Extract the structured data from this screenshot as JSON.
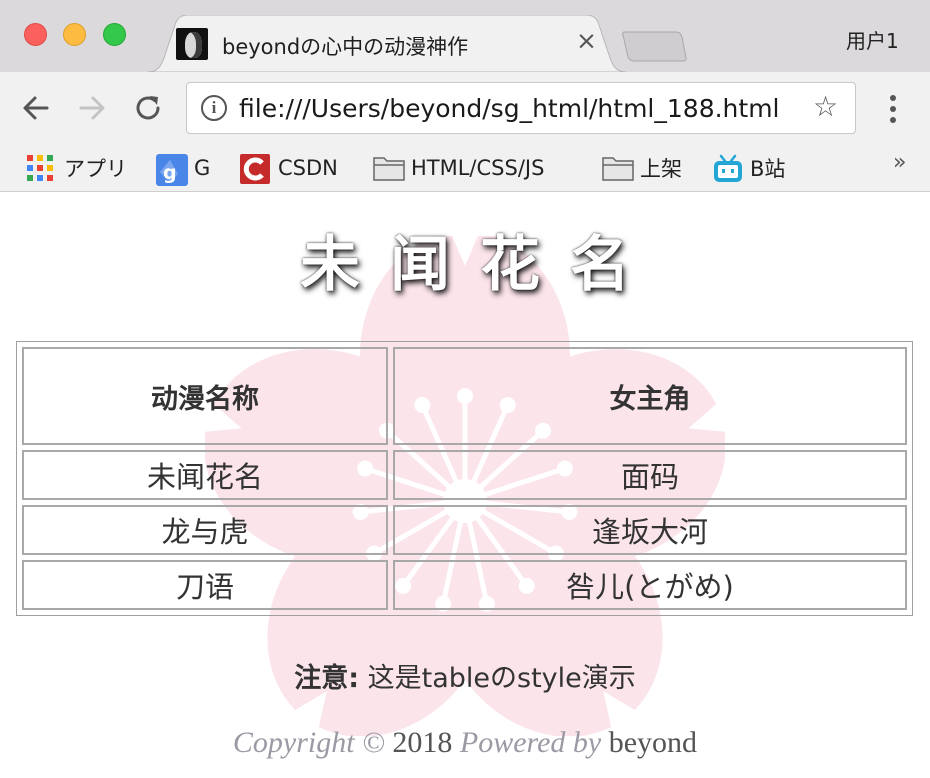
{
  "browser": {
    "tab": {
      "title": "beyondの心中の动漫神作",
      "close_glyph": "×"
    },
    "profile": "用户1",
    "address": {
      "url": "file:///Users/beyond/sg_html/html_188.html"
    },
    "bookmarks": [
      {
        "label": "アプリ",
        "icon": "apps-grid-icon"
      },
      {
        "label": "G",
        "icon": "google-icon"
      },
      {
        "label": "CSDN",
        "icon": "csdn-icon"
      },
      {
        "label": "HTML/CSS/JS",
        "icon": "folder-icon"
      },
      {
        "label": "上架",
        "icon": "folder-icon"
      },
      {
        "label": "B站",
        "icon": "bilibili-icon"
      }
    ],
    "bookmarks_overflow": "»"
  },
  "page": {
    "title": "未闻花名",
    "table": {
      "headers": [
        "动漫名称",
        "女主角"
      ],
      "rows": [
        [
          "未闻花名",
          "面码"
        ],
        [
          "龙与虎",
          "逢坂大河"
        ],
        [
          "刀语",
          "咎儿(とがめ)"
        ]
      ]
    },
    "note": {
      "label": "注意:",
      "text": " 这是tableのstyle演示"
    },
    "copyright": {
      "prefix": "Copyright © ",
      "year": "2018",
      "powered": " Powered by ",
      "author": "beyond"
    }
  },
  "colors": {
    "flower_pink": "#fbe4ea",
    "traffic_red": "#fc605c",
    "traffic_yellow": "#fdbc40",
    "traffic_green": "#34c84a"
  }
}
